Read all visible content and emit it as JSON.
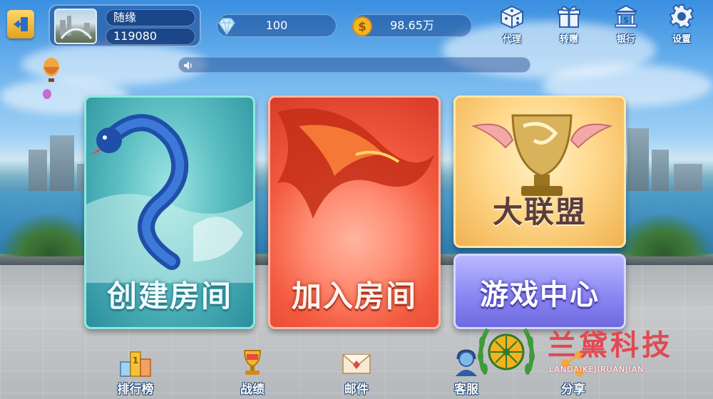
{
  "player": {
    "name": "随缘",
    "id": "119080"
  },
  "resources": {
    "diamonds": "100",
    "gold": "98.65万"
  },
  "top_menu": [
    {
      "key": "agent",
      "label": "代理",
      "icon": "dice-icon"
    },
    {
      "key": "gift",
      "label": "转赠",
      "icon": "gift-icon"
    },
    {
      "key": "bank",
      "label": "银行",
      "icon": "bank-icon"
    },
    {
      "key": "settings",
      "label": "设置",
      "icon": "gear-icon"
    }
  ],
  "cards": {
    "create_room": "创建房间",
    "join_room": "加入房间",
    "league": "大联盟",
    "game_center": "游戏中心"
  },
  "bottom_nav": [
    {
      "key": "rank",
      "label": "排行榜",
      "icon": "trophy-podium-icon"
    },
    {
      "key": "record",
      "label": "战绩",
      "icon": "medal-trophy-icon"
    },
    {
      "key": "mail",
      "label": "邮件",
      "icon": "envelope-icon"
    },
    {
      "key": "service",
      "label": "客服",
      "icon": "headset-icon"
    },
    {
      "key": "share",
      "label": "分享",
      "icon": "share-icon"
    }
  ],
  "watermark": {
    "title": "兰黛科技",
    "subtitle": "LANDAIKEJIRUANJIAN"
  },
  "colors": {
    "accent_gold": "#e2a21e",
    "watermark_red": "#e3444f",
    "panel_blue": "#1e50a0"
  }
}
